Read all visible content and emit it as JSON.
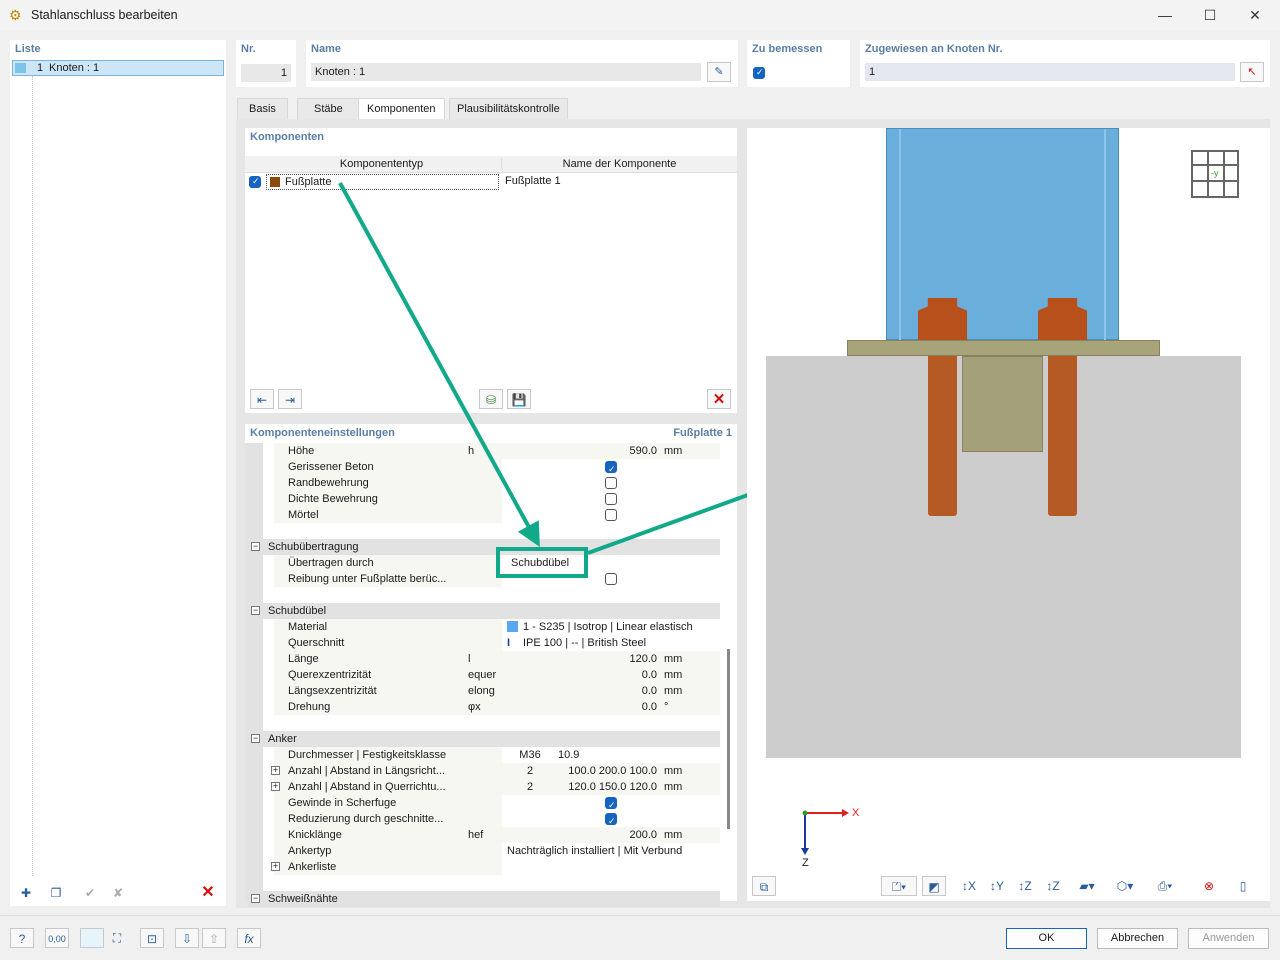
{
  "window": {
    "title": "Stahlanschluss bearbeiten",
    "minimize": "—",
    "maximize": "☐",
    "close": "✕"
  },
  "list": {
    "header": "Liste",
    "items": [
      {
        "nr": "1",
        "label": "Knoten : 1"
      }
    ]
  },
  "top": {
    "nr_label": "Nr.",
    "nr_value": "1",
    "name_label": "Name",
    "name_value": "Knoten : 1",
    "design_label": "Zu bemessen",
    "design_checked": true,
    "assigned_label": "Zugewiesen an Knoten Nr.",
    "assigned_value": "1"
  },
  "tabs": [
    {
      "label": "Basis"
    },
    {
      "label": "Stäbe"
    },
    {
      "label": "Komponenten",
      "active": true
    },
    {
      "label": "Plausibilitätskontrolle"
    }
  ],
  "components": {
    "header": "Komponenten",
    "col_type": "Komponententyp",
    "col_name": "Name der Komponente",
    "rows": [
      {
        "checked": true,
        "type": "Fußplatte",
        "name": "Fußplatte 1",
        "color": "#8b4a0c"
      }
    ]
  },
  "settings": {
    "header": "Komponenteneinstellungen",
    "component": "Fußplatte 1",
    "rows": [
      {
        "kind": "item",
        "name": "Höhe",
        "sym": "h",
        "val": "590.0",
        "unit": "mm"
      },
      {
        "kind": "item",
        "name": "Gerissener Beton",
        "cb": true
      },
      {
        "kind": "item",
        "name": "Randbewehrung",
        "cb": false
      },
      {
        "kind": "item",
        "name": "Dichte Bewehrung",
        "cb": false
      },
      {
        "kind": "item",
        "name": "Mörtel",
        "cb": false
      },
      {
        "kind": "blank"
      },
      {
        "kind": "group",
        "name": "Schubübertragung"
      },
      {
        "kind": "item",
        "name": "Übertragen durch",
        "val2": "Schubdübel",
        "highlight": true
      },
      {
        "kind": "item",
        "name": "Reibung unter Fußplatte berüc...",
        "cb": false
      },
      {
        "kind": "blank"
      },
      {
        "kind": "group",
        "name": "Schubdübel"
      },
      {
        "kind": "item",
        "name": "Material",
        "val2": "1 - S235 | Isotrop | Linear elastisch",
        "icon": "material"
      },
      {
        "kind": "item",
        "name": "Querschnitt",
        "val2": "IPE 100 | -- | British Steel",
        "icon": "section"
      },
      {
        "kind": "item",
        "name": "Länge",
        "sym": "l",
        "val": "120.0",
        "unit": "mm"
      },
      {
        "kind": "item",
        "name": "Querexzentrizität",
        "sym": "equer",
        "val": "0.0",
        "unit": "mm"
      },
      {
        "kind": "item",
        "name": "Längsexzentrizität",
        "sym": "elong",
        "val": "0.0",
        "unit": "mm"
      },
      {
        "kind": "item",
        "name": "Drehung",
        "sym": "φx",
        "val": "0.0",
        "unit": "°"
      },
      {
        "kind": "blank"
      },
      {
        "kind": "group",
        "name": "Anker"
      },
      {
        "kind": "item",
        "name": "Durchmesser | Festigkeitsklasse",
        "a": "M36",
        "b": "10.9"
      },
      {
        "kind": "item",
        "name": "Anzahl | Abstand in Längsricht...",
        "a": "2",
        "val": "100.0 200.0 100.0",
        "unit": "mm",
        "exp": true
      },
      {
        "kind": "item",
        "name": "Anzahl | Abstand in Querrichtu...",
        "a": "2",
        "val": "120.0 150.0 120.0",
        "unit": "mm",
        "exp": true
      },
      {
        "kind": "item",
        "name": "Gewinde in Scherfuge",
        "cb": true
      },
      {
        "kind": "item",
        "name": "Reduzierung durch geschnitte...",
        "cb": true
      },
      {
        "kind": "item",
        "name": "Knicklänge",
        "sym": "hef",
        "val": "200.0",
        "unit": "mm"
      },
      {
        "kind": "item",
        "name": "Ankertyp",
        "val2": "Nachträglich installiert | Mit Verbund"
      },
      {
        "kind": "item",
        "name": "Ankerliste",
        "exp": true
      },
      {
        "kind": "blank"
      },
      {
        "kind": "group",
        "name": "Schweißnähte"
      }
    ]
  },
  "view": {
    "axis_x": "X",
    "axis_z": "Z",
    "view_label": "-y",
    "colors": {
      "column": "#6aaedc",
      "plate": "#a8a47a",
      "concrete": "#cdcdcd",
      "bolt": "#b55a24",
      "key": "#a3a07a"
    }
  },
  "footer": {
    "ok": "OK",
    "cancel": "Abbrechen",
    "apply": "Anwenden",
    "units": "0,00"
  },
  "colors": {
    "accent": "#1565c0",
    "annotation": "#12a98a",
    "header": "#5a7ea6"
  }
}
